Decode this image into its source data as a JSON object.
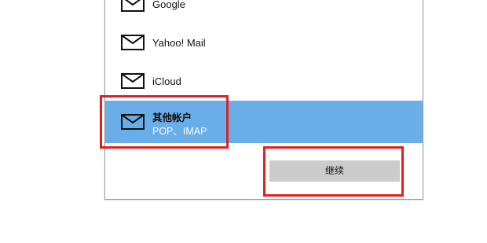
{
  "accounts": [
    {
      "label": "Google",
      "icon": "mail-icon",
      "selected": false
    },
    {
      "label": "Yahoo! Mail",
      "icon": "mail-icon",
      "selected": false
    },
    {
      "label": "iCloud",
      "icon": "mail-icon",
      "selected": false
    },
    {
      "label": "其他帐户",
      "sublabel": "POP、IMAP",
      "icon": "mail-icon",
      "selected": true
    }
  ],
  "continue_label": "继续",
  "colors": {
    "selection": "#6aaee8",
    "button": "#cccccc",
    "highlight": "#e02020"
  }
}
